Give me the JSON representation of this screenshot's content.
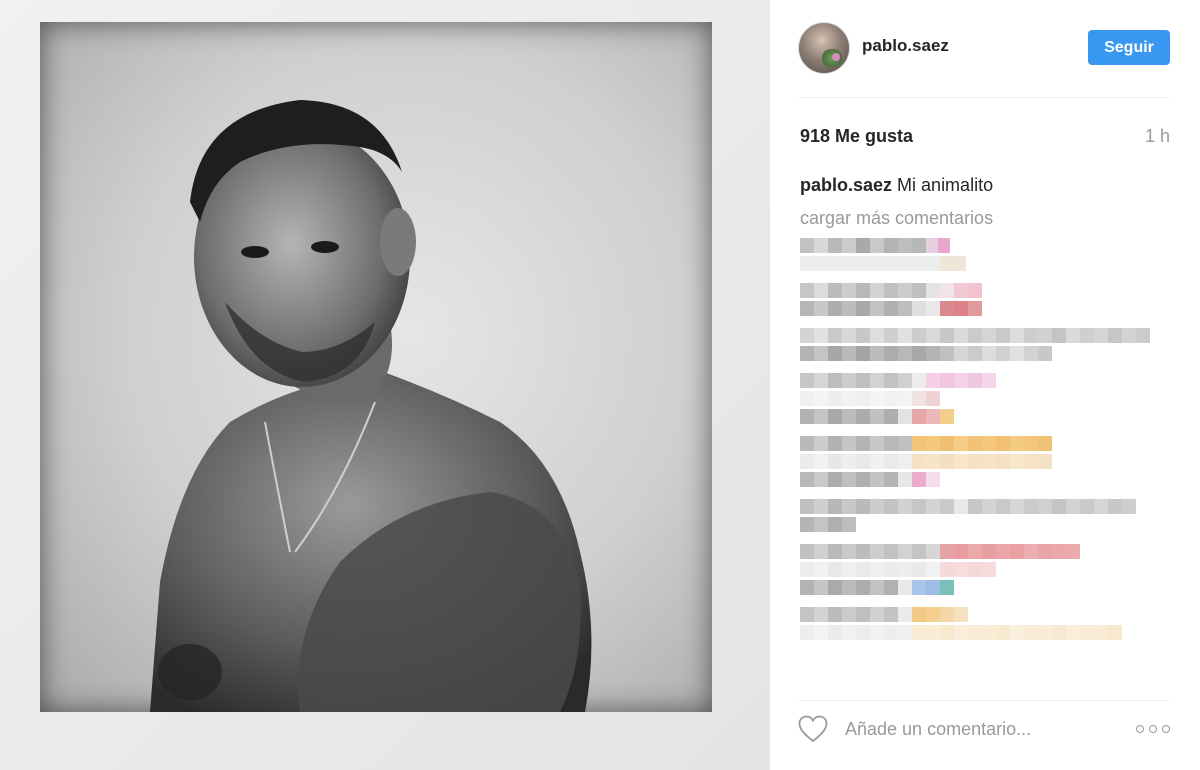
{
  "post": {
    "username": "pablo.saez",
    "follow_label": "Seguir",
    "likes": "918 Me gusta",
    "time": "1 h",
    "caption_user": "pablo.saez",
    "caption_text": "Mi animalito",
    "load_more": "cargar más comentarios",
    "comment_placeholder": "Añade un comentario..."
  },
  "icons": {
    "like": "heart-icon",
    "more": "more-options-icon"
  },
  "colors": {
    "accent": "#3897f0",
    "muted_text": "#999999",
    "text": "#262626"
  }
}
